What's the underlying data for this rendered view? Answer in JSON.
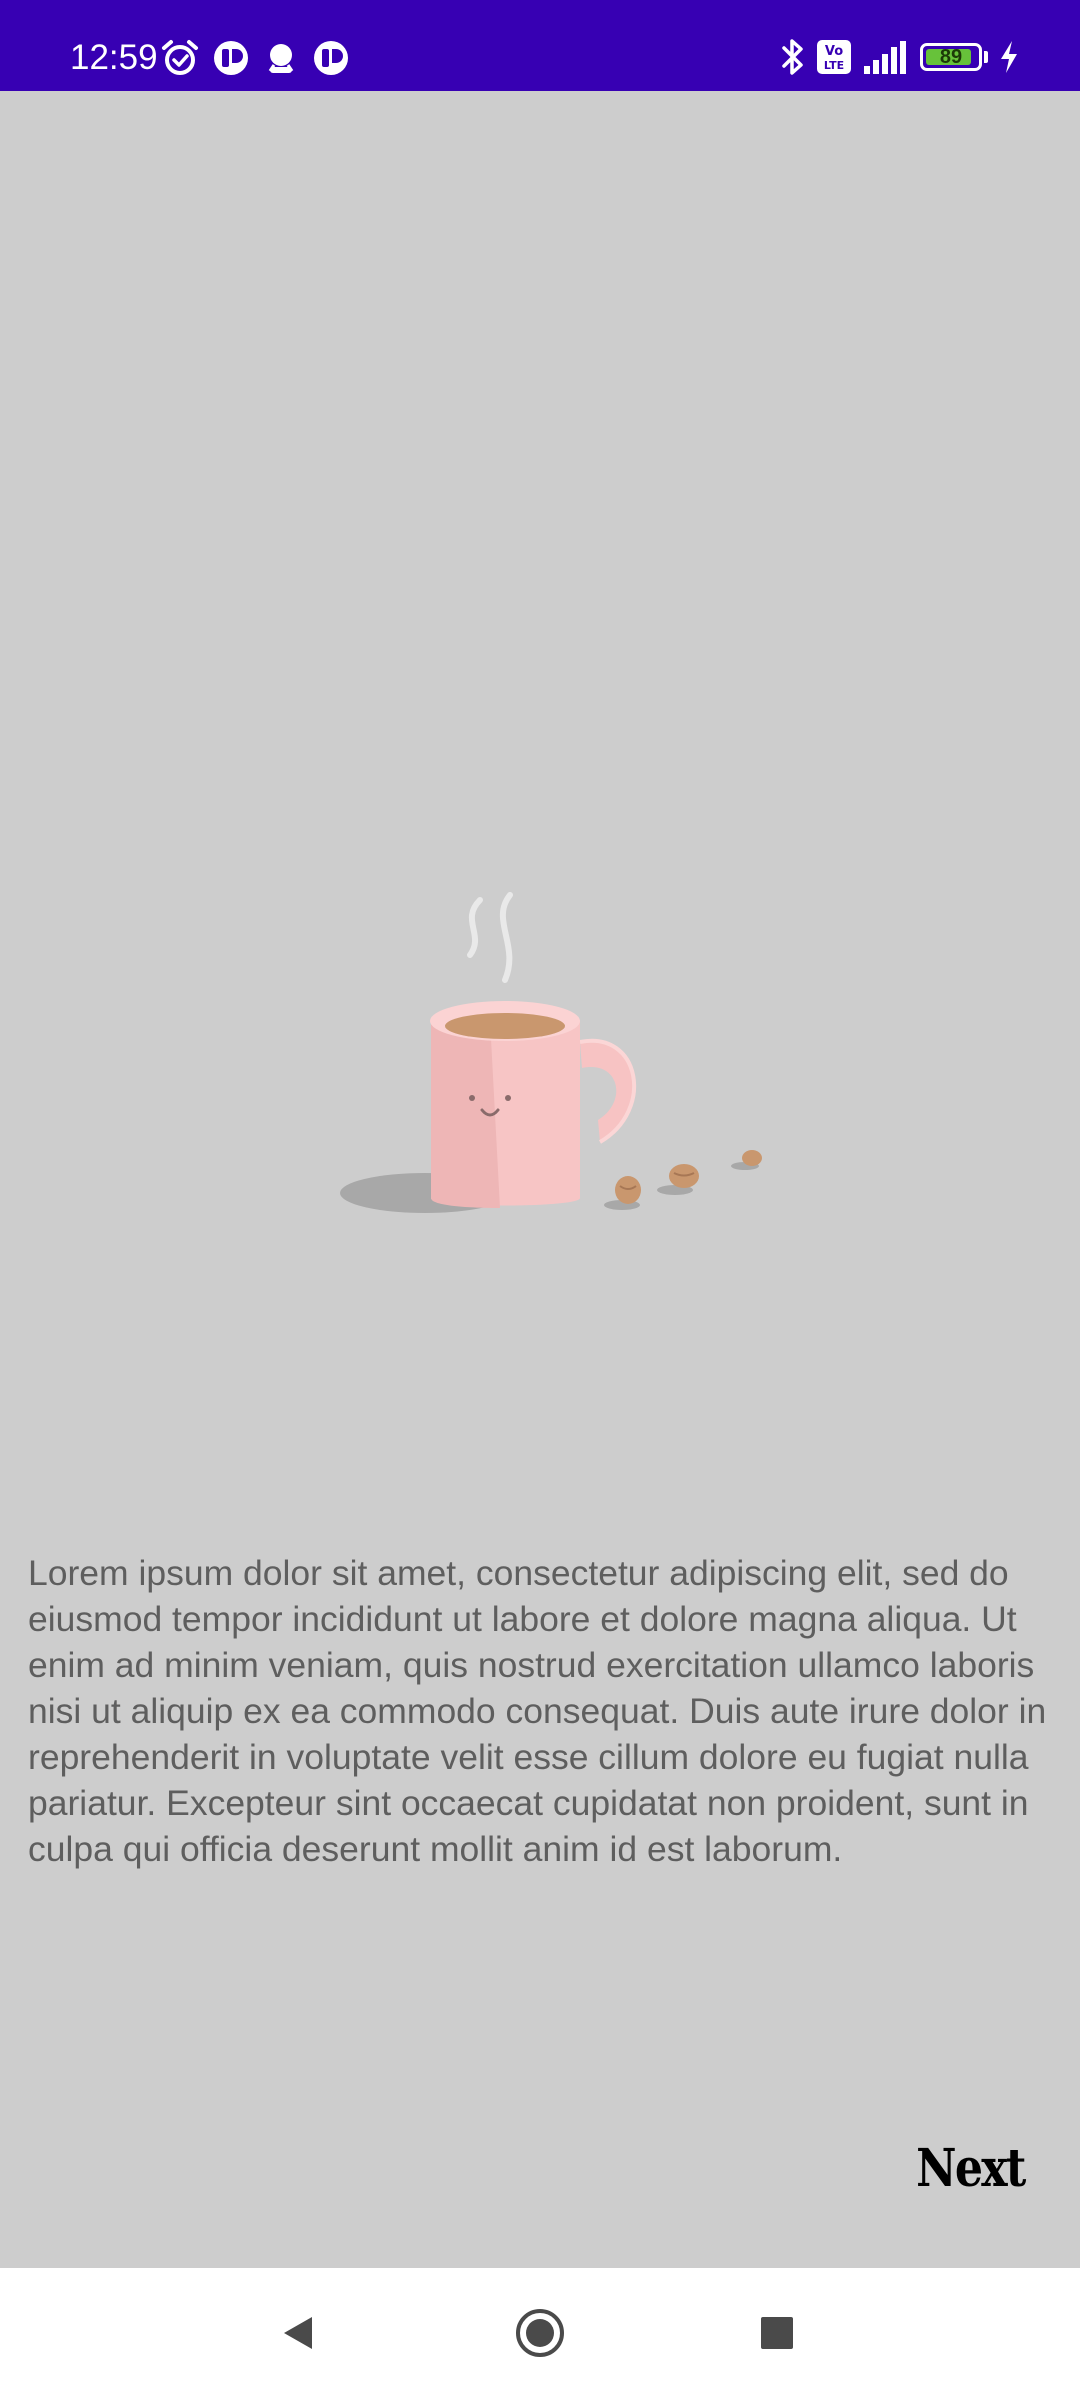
{
  "status_bar": {
    "time": "12:59",
    "battery_level": "89",
    "background_color": "#3700b3",
    "left_icons": [
      "alarm-icon",
      "app-notification-icon",
      "robot-notification-icon",
      "app-notification-icon"
    ],
    "right_icons": [
      "bluetooth-icon",
      "volte-icon",
      "signal-icon",
      "battery-icon",
      "charging-icon"
    ]
  },
  "illustration": {
    "subject": "coffee-mug-icon"
  },
  "content": {
    "body": "Lorem ipsum dolor sit amet, consectetur adipiscing elit, sed do eiusmod tempor incididunt ut labore et dolore magna aliqua. Ut enim ad minim veniam, quis nostrud exercitation ullamco laboris nisi ut aliquip ex ea commodo consequat. Duis aute irure dolor in reprehenderit in voluptate velit esse cillum dolore eu fugiat nulla pariatur. Excepteur sint occaecat cupidatat non proident, sunt in culpa qui officia deserunt mollit anim id est laborum."
  },
  "actions": {
    "next_label": "Next"
  },
  "nav_bar": {
    "buttons": [
      "back-icon",
      "home-icon",
      "recents-icon"
    ]
  },
  "colors": {
    "background": "#cdcdcd",
    "text": "#5e5e5e",
    "mug": "#f7c5c5"
  }
}
